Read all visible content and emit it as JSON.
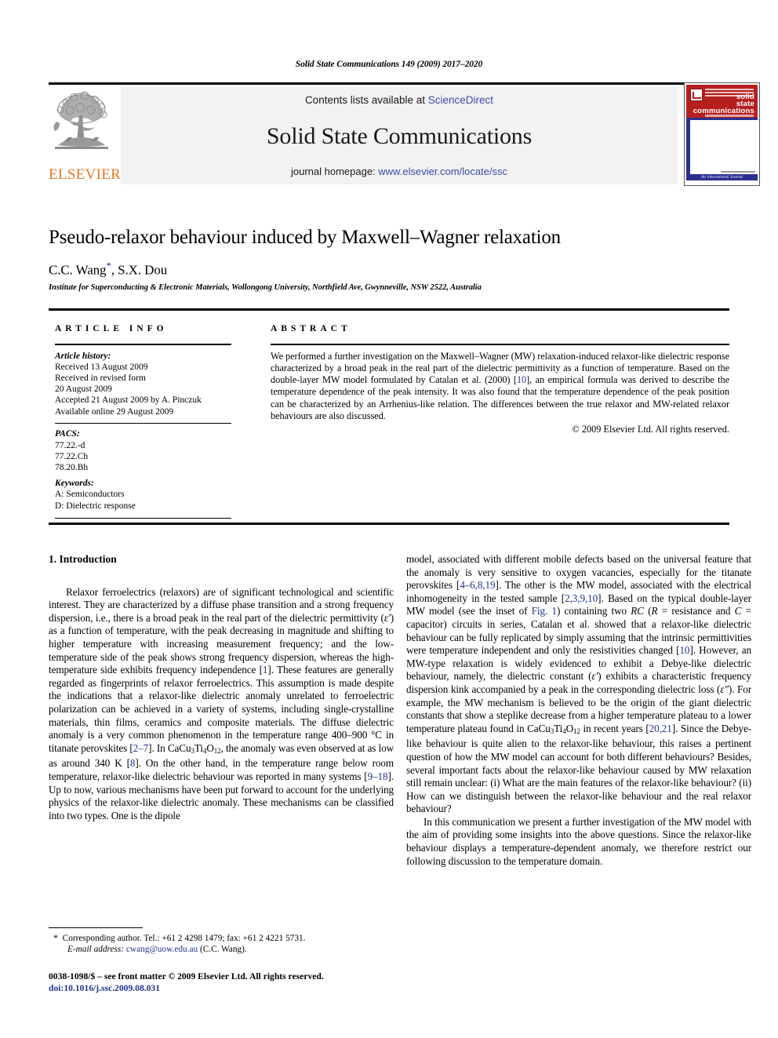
{
  "running_head": "Solid State Communications 149 (2009) 2017–2020",
  "masthead": {
    "publisher_wordmark": "ELSEVIER",
    "contents_prefix": "Contents lists available at ",
    "contents_link": "ScienceDirect",
    "journal_title": "Solid State Communications",
    "homepage_prefix": "journal homepage: ",
    "homepage_link": "www.elsevier.com/locate/ssc",
    "cover": {
      "line1": "solid",
      "line2": "state",
      "line3": "communications",
      "footer_text": "An International Journal"
    }
  },
  "title_block": {
    "title": "Pseudo-relaxor behaviour induced by Maxwell–Wagner relaxation",
    "authors": "C.C. Wang",
    "authors_tail": ", S.X. Dou",
    "corresponding_marker": "*",
    "affiliation": "Institute for Superconducting & Electronic Materials, Wollongong University, Northfield Ave, Gwynneville, NSW 2522, Australia"
  },
  "article_info": {
    "heading": "ARTICLE INFO",
    "history_label": "Article history:",
    "history": [
      "Received 13 August 2009",
      "Received in revised form",
      "20 August 2009",
      "Accepted 21 August 2009 by A. Pinczuk",
      "Available online 29 August 2009"
    ],
    "pacs_label": "PACS:",
    "pacs": [
      "77.22.-d",
      "77.22.Ch",
      "78.20.Bh"
    ],
    "keywords_label": "Keywords:",
    "keywords": [
      "A: Semiconductors",
      "D: Dielectric response"
    ]
  },
  "abstract": {
    "heading": "ABSTRACT",
    "part1": "We performed a further investigation on the Maxwell–Wagner (MW) relaxation-induced relaxor-like dielectric response characterized by a broad peak in the real part of the dielectric permittivity as a function of temperature. Based on the double-layer MW model formulated by Catalan et al. (2000) [",
    "ref1": "10",
    "part2": "], an empirical formula was derived to describe the temperature dependence of the peak intensity. It was also found that the temperature dependence of the peak position can be characterized by an Arrhenius-like relation. The differences between the true relaxor and MW-related relaxor behaviours are also discussed.",
    "copyright": "© 2009 Elsevier Ltd. All rights reserved."
  },
  "body": {
    "section_heading": "1. Introduction",
    "left": {
      "p1_a": "Relaxor ferroelectrics (relaxors) are of significant technological and scientific interest. They are characterized by a diffuse phase transition and a strong frequency dispersion, i.e., there is a broad peak in the real part of the dielectric permittivity (",
      "p1_eps": "ε′",
      "p1_b": ") as a function of temperature, with the peak decreasing in magnitude and shifting to higher temperature with increasing measurement frequency; and the low-temperature side of the peak shows strong frequency dispersion, whereas the high-temperature side exhibits frequency independence [",
      "p1_ref1": "1",
      "p1_c": "]. These features are generally regarded as fingerprints of relaxor ferroelectrics. This assumption is made despite the indications that a relaxor-like dielectric anomaly unrelated to ferroelectric polarization can be achieved in a variety of systems, including single-crystalline materials, thin films, ceramics and composite materials. The diffuse dielectric anomaly is a very common phenomenon in the temperature range 400–900 °C in titanate perovskites [",
      "p1_ref2": "2–7",
      "p1_d": "]. In CaCu",
      "p1_sub1": "3",
      "p1_e": "Ti",
      "p1_sub2": "4",
      "p1_f": "O",
      "p1_sub3": "12",
      "p1_g": ", the anomaly was even observed at as low as around 340 K [",
      "p1_ref3": "8",
      "p1_h": "]. On the other hand, in the temperature range below room temperature, relaxor-like dielectric behaviour was reported in many systems [",
      "p1_ref4": "9–18",
      "p1_i": "]. Up to now, various mechanisms have been put forward to account for the underlying physics of the relaxor-like dielectric anomaly. These mechanisms can be classified into two types. One is the dipole"
    },
    "right": {
      "p1_a": "model, associated with different mobile defects based on the universal feature that the anomaly is very sensitive to oxygen vacancies, especially for the titanate perovskites [",
      "p1_ref1": "4–6,8,19",
      "p1_b": "]. The other is the MW model, associated with the electrical inhomogeneity in the tested sample [",
      "p1_ref2": "2,3,9,10",
      "p1_c": "]. Based on the typical double-layer MW model (see the inset of ",
      "p1_figref": "Fig. 1",
      "p1_d": ") containing two ",
      "p1_rc": "RC",
      "p1_e": " (",
      "p1_R": "R",
      "p1_f": " = resistance and ",
      "p1_C": "C",
      "p1_g": " = capacitor) circuits in series, Catalan et al. showed that a relaxor-like dielectric behaviour can be fully replicated by simply assuming that the intrinsic permittivities were temperature independent and only the resistivities changed [",
      "p1_ref3": "10",
      "p1_h": "]. However, an MW-type relaxation is widely evidenced to exhibit a Debye-like dielectric behaviour, namely, the dielectric constant (",
      "p1_eps1": "ε′",
      "p1_i": ") exhibits a characteristic frequency dispersion kink accompanied by a peak in the corresponding dielectric loss (",
      "p1_eps2": "ε″",
      "p1_j": "). For example, the MW mechanism is believed to be the origin of the giant dielectric constants that show a steplike decrease from a higher temperature plateau to a lower temperature plateau found in CaCu",
      "p1_sub1": "3",
      "p1_k": "Ti",
      "p1_sub2": "4",
      "p1_l": "O",
      "p1_sub3": "12",
      "p1_m": " in recent years [",
      "p1_ref4": "20,21",
      "p1_n": "]. Since the Debye-like behaviour is quite alien to the relaxor-like behaviour, this raises a pertinent question of how the MW model can account for both different behaviours? Besides, several important facts about the relaxor-like behaviour caused by MW relaxation still remain unclear: (i) What are the main features of the relaxor-like behaviour? (ii) How can we distinguish between the relaxor-like behaviour and the real relaxor behaviour?",
      "p2": "In this communication we present a further investigation of the MW model with the aim of providing some insights into the above questions. Since the relaxor-like behaviour displays a temperature-dependent anomaly, we therefore restrict our following discussion to the temperature domain."
    }
  },
  "footnote": {
    "star": "*",
    "corresponding": "Corresponding author. Tel.: +61 2 4298 1479; fax: +61 2 4221 5731.",
    "email_label": "E-mail address:",
    "email": "cwang@uow.edu.au",
    "email_owner": "(C.C. Wang)."
  },
  "footer": {
    "issn_line": "0038-1098/$ – see front matter © 2009 Elsevier Ltd. All rights reserved.",
    "doi_label": "doi:",
    "doi": "10.1016/j.ssc.2009.08.031"
  },
  "colors": {
    "link": "#22338c",
    "sciencedirect": "#3b4ba8",
    "elsevier_orange": "#E87722",
    "cover_red": "#b5201f",
    "cover_blue": "#2b2f8f"
  }
}
